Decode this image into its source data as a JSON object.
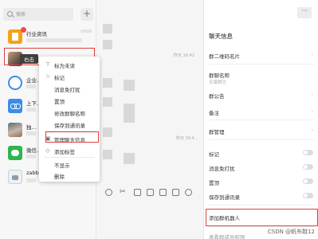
{
  "search": {
    "placeholder": "搜索"
  },
  "chat_list": {
    "items": [
      {
        "name": "行业资讯",
        "avatar": "industry-news-avatar"
      },
      {
        "name": "太…",
        "avatar": "group-photo-avatar"
      },
      {
        "name": "企业…",
        "avatar": "wecom-avatar"
      },
      {
        "name": "上下…",
        "avatar": "chain-avatar"
      },
      {
        "name": "独…",
        "avatar": "person-avatar"
      },
      {
        "name": "微信…",
        "avatar": "green-chat-avatar"
      },
      {
        "name": "zabb…",
        "avatar": "robot-avatar"
      }
    ],
    "right_click_tag": "右击"
  },
  "context_menu": {
    "items": [
      {
        "icon": "pin-icon",
        "icon_glyph": "⊤",
        "label": "标为未读"
      },
      {
        "icon": "star-icon",
        "icon_glyph": "☆",
        "label": "标记"
      },
      {
        "icon": "",
        "icon_glyph": "",
        "label": "消息免打扰"
      },
      {
        "icon": "",
        "icon_glyph": "",
        "label": "置顶"
      },
      {
        "icon": "",
        "icon_glyph": "",
        "label": "修改群聊名称"
      },
      {
        "icon": "",
        "icon_glyph": "",
        "label": "保存到通讯录"
      },
      {
        "icon": "info-icon",
        "icon_glyph": "▣",
        "label": "管理聊天信息"
      },
      {
        "icon": "tag-icon",
        "icon_glyph": "◇",
        "label": "添加标签"
      },
      {
        "icon": "",
        "icon_glyph": "",
        "label": "不显示"
      },
      {
        "icon": "",
        "icon_glyph": "",
        "label": "删除"
      }
    ]
  },
  "chat_area": {
    "timestamps": [
      "昨天 16:42",
      "昨天 16:4…"
    ]
  },
  "info_panel": {
    "title": "聊天信息",
    "rows": {
      "qr_code": "群二维码名片",
      "group_name_label": "群聊名称",
      "group_name_value": "天章顾文",
      "announcement": "群公告",
      "remark": "备注",
      "manage": "群管理",
      "mark": "标记",
      "mute": "消息免打扰",
      "pin": "置顶",
      "save_contacts": "保存到通讯录",
      "add_bot": "添加群机器人",
      "view_more": "查看群成员权限"
    }
  },
  "watermark": "CSDN @帆布鞋12",
  "colors": {
    "highlight": "#e0413c",
    "badge": "#f04b4b",
    "wecom_blue": "#3b8de8"
  }
}
